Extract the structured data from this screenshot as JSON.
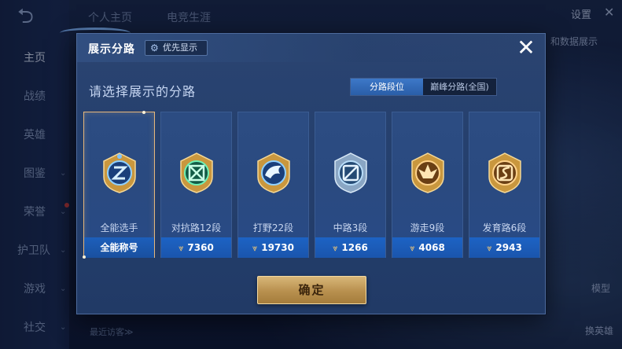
{
  "background": {
    "top_tabs": [
      "个人主页",
      "电竞生涯"
    ],
    "settings_label": "设置",
    "close_label": "✕",
    "nav_items": [
      {
        "label": "主页",
        "has_chevron": false
      },
      {
        "label": "战绩",
        "has_chevron": false
      },
      {
        "label": "英雄",
        "has_chevron": false
      },
      {
        "label": "图鉴",
        "has_chevron": true
      },
      {
        "label": "荣誉",
        "has_chevron": true
      },
      {
        "label": "护卫队",
        "has_chevron": true
      },
      {
        "label": "游戏",
        "has_chevron": true
      },
      {
        "label": "社交",
        "has_chevron": true
      }
    ],
    "side_labels": {
      "data_display": "和数据展示",
      "model": "模型",
      "change_hero": "换英雄"
    },
    "recent_visitors": "最近访客≫"
  },
  "modal": {
    "title": "展示分路",
    "priority_label": "优先显示",
    "close_label": "✕",
    "subtitle": "请选择展示的分路",
    "toggle": {
      "options": [
        "分路段位",
        "巅峰分路(全国)"
      ],
      "selected": "分路段位"
    },
    "cards": [
      {
        "label": "全能选手",
        "footer": "全能称号",
        "score": null,
        "selected": true,
        "emblem": "all-round-emblem-icon",
        "color": "#5aa8e8"
      },
      {
        "label": "对抗路12段",
        "footer": "7360",
        "score": 7360,
        "selected": false,
        "emblem": "clash-lane-emblem-icon",
        "color": "#3fce8a"
      },
      {
        "label": "打野22段",
        "footer": "19730",
        "score": 19730,
        "selected": false,
        "emblem": "jungle-emblem-icon",
        "color": "#5aa8e8"
      },
      {
        "label": "中路3段",
        "footer": "1266",
        "score": 1266,
        "selected": false,
        "emblem": "mid-lane-emblem-icon",
        "color": "#7fb8e0"
      },
      {
        "label": "游走9段",
        "footer": "4068",
        "score": 4068,
        "selected": false,
        "emblem": "roam-emblem-icon",
        "color": "#e0a858"
      },
      {
        "label": "发育路6段",
        "footer": "2943",
        "score": 2943,
        "selected": false,
        "emblem": "farm-lane-emblem-icon",
        "color": "#e0a858"
      }
    ],
    "confirm_label": "确定"
  }
}
